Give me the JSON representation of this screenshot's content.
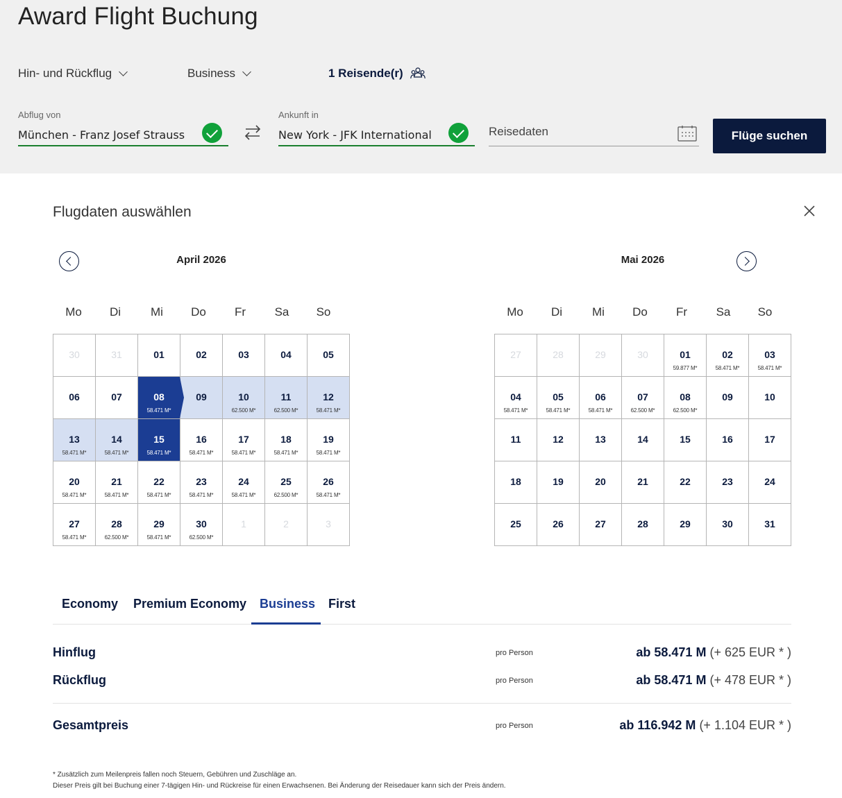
{
  "header": {
    "title": "Award Flight Buchung",
    "trip_type": "Hin- und Rückflug",
    "cabin": "Business",
    "travellers": "1 Reisende(r)"
  },
  "search": {
    "from_label": "Abflug von",
    "from_value": "München - Franz Josef Strauss",
    "to_label": "Ankunft in",
    "to_value": "New York - JFK International",
    "dates_placeholder": "Reisedaten",
    "search_button": "Flüge suchen"
  },
  "calendar": {
    "title": "Flugdaten auswählen",
    "weekdays": [
      "Mo",
      "Di",
      "Mi",
      "Do",
      "Fr",
      "Sa",
      "So"
    ],
    "months": [
      {
        "title": "April 2026",
        "days": [
          {
            "d": "30",
            "muted": true
          },
          {
            "d": "31",
            "muted": true
          },
          {
            "d": "01"
          },
          {
            "d": "02"
          },
          {
            "d": "03"
          },
          {
            "d": "04"
          },
          {
            "d": "05"
          },
          {
            "d": "06"
          },
          {
            "d": "07"
          },
          {
            "d": "08",
            "p": "58.471 M*",
            "state": "sel-start"
          },
          {
            "d": "09",
            "state": "range"
          },
          {
            "d": "10",
            "p": "62.500 M*",
            "state": "range"
          },
          {
            "d": "11",
            "p": "62.500 M*",
            "state": "range"
          },
          {
            "d": "12",
            "p": "58.471 M*",
            "state": "range"
          },
          {
            "d": "13",
            "p": "58.471 M*",
            "state": "range"
          },
          {
            "d": "14",
            "p": "58.471 M*",
            "state": "range"
          },
          {
            "d": "15",
            "p": "58.471 M*",
            "state": "sel"
          },
          {
            "d": "16",
            "p": "58.471 M*"
          },
          {
            "d": "17",
            "p": "58.471 M*"
          },
          {
            "d": "18",
            "p": "58.471 M*"
          },
          {
            "d": "19",
            "p": "58.471 M*"
          },
          {
            "d": "20",
            "p": "58.471 M*"
          },
          {
            "d": "21",
            "p": "58.471 M*"
          },
          {
            "d": "22",
            "p": "58.471 M*"
          },
          {
            "d": "23",
            "p": "58.471 M*"
          },
          {
            "d": "24",
            "p": "58.471 M*"
          },
          {
            "d": "25",
            "p": "62.500 M*"
          },
          {
            "d": "26",
            "p": "58.471 M*"
          },
          {
            "d": "27",
            "p": "58.471 M*"
          },
          {
            "d": "28",
            "p": "62.500 M*"
          },
          {
            "d": "29",
            "p": "58.471 M*"
          },
          {
            "d": "30",
            "p": "62.500 M*"
          },
          {
            "d": "1",
            "muted": true
          },
          {
            "d": "2",
            "muted": true
          },
          {
            "d": "3",
            "muted": true
          }
        ]
      },
      {
        "title": "Mai 2026",
        "days": [
          {
            "d": "27",
            "muted": true
          },
          {
            "d": "28",
            "muted": true
          },
          {
            "d": "29",
            "muted": true
          },
          {
            "d": "30",
            "muted": true
          },
          {
            "d": "01",
            "p": "59.877 M*"
          },
          {
            "d": "02",
            "p": "58.471 M*"
          },
          {
            "d": "03",
            "p": "58.471 M*"
          },
          {
            "d": "04",
            "p": "58.471 M*"
          },
          {
            "d": "05",
            "p": "58.471 M*"
          },
          {
            "d": "06",
            "p": "58.471 M*"
          },
          {
            "d": "07",
            "p": "62.500 M*"
          },
          {
            "d": "08",
            "p": "62.500 M*"
          },
          {
            "d": "09"
          },
          {
            "d": "10"
          },
          {
            "d": "11"
          },
          {
            "d": "12"
          },
          {
            "d": "13"
          },
          {
            "d": "14"
          },
          {
            "d": "15"
          },
          {
            "d": "16"
          },
          {
            "d": "17"
          },
          {
            "d": "18"
          },
          {
            "d": "19"
          },
          {
            "d": "20"
          },
          {
            "d": "21"
          },
          {
            "d": "22"
          },
          {
            "d": "23"
          },
          {
            "d": "24"
          },
          {
            "d": "25"
          },
          {
            "d": "26"
          },
          {
            "d": "27"
          },
          {
            "d": "28"
          },
          {
            "d": "29"
          },
          {
            "d": "30"
          },
          {
            "d": "31"
          }
        ]
      }
    ]
  },
  "tabs": [
    "Economy",
    "Premium Economy",
    "Business",
    "First"
  ],
  "active_tab": "Business",
  "prices": {
    "outbound": {
      "label": "Hinflug",
      "per": "pro Person",
      "miles": "ab 58.471 M",
      "eur": "(+ 625 EUR * )"
    },
    "return": {
      "label": "Rückflug",
      "per": "pro Person",
      "miles": "ab 58.471 M",
      "eur": "(+ 478 EUR * )"
    },
    "total": {
      "label": "Gesamtpreis",
      "per": "pro Person",
      "miles": "ab 116.942 M",
      "eur": "(+ 1.104 EUR * )"
    }
  },
  "footnote": {
    "line1": "* Zusätzlich zum Meilenpreis fallen noch Steuern, Gebühren und Zuschläge an.",
    "line2": "Dieser Preis gilt bei Buchung einer 7-tägigen Hin- und Rückreise für einen Erwachsenen. Bei Änderung der Reisedauer kann sich der Preis ändern."
  },
  "colors": {
    "brand_navy": "#0b1a3d",
    "selected_day": "#1b3d93",
    "range_day": "#d5dff2",
    "valid_green": "#10a13a"
  },
  "icons": [
    "chevron-down-icon",
    "travellers-icon",
    "check-icon",
    "swap-icon",
    "calendar-icon",
    "close-icon",
    "arrow-left-icon",
    "arrow-right-icon"
  ]
}
